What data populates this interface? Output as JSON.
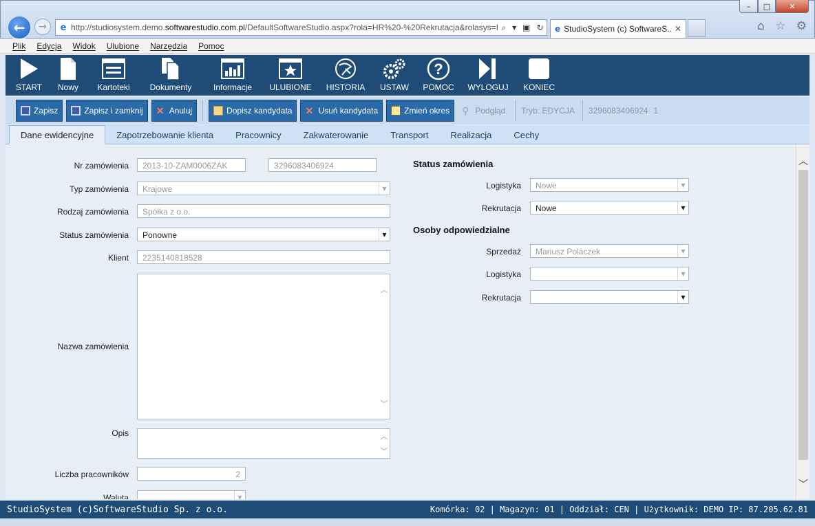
{
  "browser": {
    "url_prefix": "http://studiosystem.demo.",
    "url_domain": "softwarestudio.com.pl",
    "url_rest": "/DefaultSoftwareStudio.aspx?rola=HR%20-%20Rekrutacja&rolasys=I",
    "tab_title": "StudioSystem (c) SoftwareS...",
    "tab_close": "✕"
  },
  "menu": [
    "Plik",
    "Edycja",
    "Widok",
    "Ulubione",
    "Narzędzia",
    "Pomoc"
  ],
  "toolbar": [
    "START",
    "Nowy",
    "Kartoteki",
    "Dokumenty",
    "Informacje",
    "ULUBIONE",
    "HISTORIA",
    "USTAW",
    "POMOC",
    "WYLOGUJ",
    "KONIEC"
  ],
  "actions": {
    "save": "Zapisz",
    "save_close": "Zapisz i zamknij",
    "cancel": "Anuluj",
    "add_candidate": "Dopisz kandydata",
    "remove_candidate": "Usuń kandydata",
    "change_period": "Zmień okres",
    "preview": "Podgląd",
    "mode": "Tryb: EDYCJA",
    "record_id": "3296083406924",
    "record_num": "1"
  },
  "tabs": [
    "Dane ewidencyjne",
    "Zapotrzebowanie klienta",
    "Pracownicy",
    "Zakwaterowanie",
    "Transport",
    "Realizacja",
    "Cechy"
  ],
  "form": {
    "order_no_label": "Nr zamówienia",
    "order_no": "2013-10-ZAM0006ZAK",
    "order_id": "3296083406924",
    "order_type_label": "Typ zamówienia",
    "order_type": "Krajowe",
    "order_kind_label": "Rodzaj zamówienia",
    "order_kind": "Spółka z o.o.",
    "order_status_label": "Status zamówienia",
    "order_status": "Ponowne",
    "client_label": "Klient",
    "client": "2235140818528",
    "order_name_label": "Nazwa zamówienia",
    "description_label": "Opis",
    "workers_label": "Liczba pracowników",
    "workers": "2",
    "currency_label": "Waluta"
  },
  "status_section": {
    "title": "Status zamówienia",
    "logistics_label": "Logistyka",
    "logistics": "Nowe",
    "recruitment_label": "Rekrutacja",
    "recruitment": "Nowe"
  },
  "responsible_section": {
    "title": "Osoby odpowiedzialne",
    "sales_label": "Sprzedaż",
    "sales": "Mariusz Polaczek",
    "logistics_label": "Logistyka",
    "recruitment_label": "Rekrutacja"
  },
  "statusbar": {
    "left": "StudioSystem (c)SoftwareStudio Sp. z o.o.",
    "right": "Komórka: 02 | Magazyn: 01 | Oddział: CEN | Użytkownik: DEMO IP: 87.205.62.81"
  }
}
